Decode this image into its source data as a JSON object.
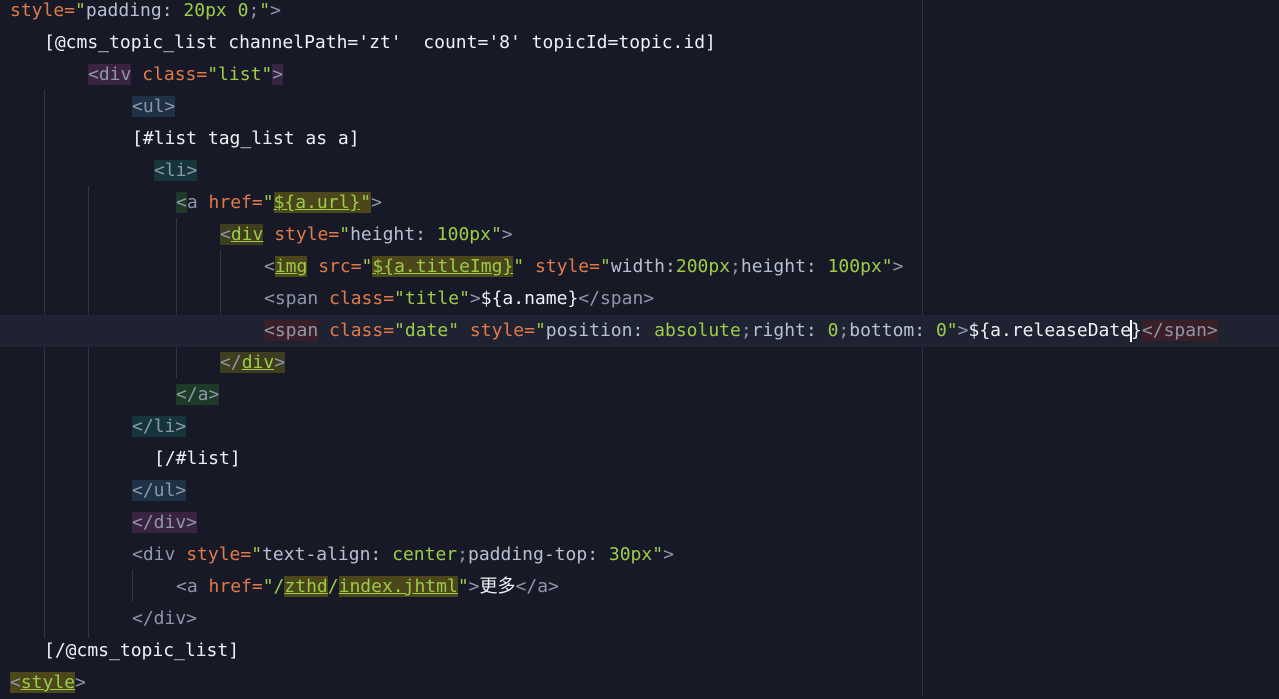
{
  "editor": {
    "lines": [
      {
        "indent": 0,
        "tokens": [
          {
            "t": "style=",
            "c": "tok-attr"
          },
          {
            "t": "\"",
            "c": "tok-str"
          },
          {
            "t": "padding: ",
            "c": "tok-css"
          },
          {
            "t": "20px 0",
            "c": "tok-val"
          },
          {
            "t": ";",
            "c": "tok-punct"
          },
          {
            "t": "\"",
            "c": "tok-str"
          },
          {
            "t": ">",
            "c": "tok-punct"
          }
        ]
      },
      {
        "indent": 1,
        "tokens": [
          {
            "t": "[@cms_topic_list channelPath='zt'  count='8' topicId=topic.id]",
            "c": "tok-ftl"
          }
        ]
      },
      {
        "indent": 2,
        "tokens": [
          {
            "t": "<div",
            "c": "tok-tag",
            "h": "hl-purple"
          },
          {
            "t": " class=",
            "c": "tok-attr"
          },
          {
            "t": "\"list\"",
            "c": "tok-str"
          },
          {
            "t": ">",
            "c": "tok-punct",
            "h": "hl-purple"
          }
        ]
      },
      {
        "indent": 3,
        "tokens": [
          {
            "t": "<ul>",
            "c": "tok-tag",
            "h": "hl-blue"
          }
        ]
      },
      {
        "indent": 3,
        "tokens": [
          {
            "t": "[#list tag_list as a]",
            "c": "tok-ftl"
          }
        ]
      },
      {
        "indent": 3.5,
        "tokens": [
          {
            "t": "<li>",
            "c": "tok-tag",
            "h": "hl-teal"
          }
        ]
      },
      {
        "indent": 4,
        "tokens": [
          {
            "t": "<",
            "c": "tok-tag",
            "h": "hl-green"
          },
          {
            "t": "a",
            "c": "tok-tag"
          },
          {
            "t": " href=",
            "c": "tok-attr"
          },
          {
            "t": "\"",
            "c": "tok-str"
          },
          {
            "t": "${a.url}",
            "c": "tok-link",
            "h": "hl-gold"
          },
          {
            "t": "\"",
            "c": "tok-str",
            "h": "hl-gold"
          },
          {
            "t": ">",
            "c": "tok-punct"
          }
        ]
      },
      {
        "indent": 5,
        "tokens": [
          {
            "t": "<",
            "c": "tok-tag",
            "h": "hl-olive"
          },
          {
            "t": "div",
            "c": "tok-link",
            "h": "hl-olive"
          },
          {
            "t": " style=",
            "c": "tok-attr"
          },
          {
            "t": "\"",
            "c": "tok-str"
          },
          {
            "t": "height: ",
            "c": "tok-css"
          },
          {
            "t": "100px",
            "c": "tok-val"
          },
          {
            "t": "\"",
            "c": "tok-str"
          },
          {
            "t": ">",
            "c": "tok-punct"
          }
        ]
      },
      {
        "indent": 6,
        "tokens": [
          {
            "t": "<",
            "c": "tok-tag"
          },
          {
            "t": "img",
            "c": "tok-link",
            "h": "hl-gold"
          },
          {
            "t": " src=",
            "c": "tok-attr"
          },
          {
            "t": "\"",
            "c": "tok-str"
          },
          {
            "t": "${a.titleImg}",
            "c": "tok-link",
            "h": "hl-gold"
          },
          {
            "t": "\"",
            "c": "tok-str"
          },
          {
            "t": " style=",
            "c": "tok-attr"
          },
          {
            "t": "\"",
            "c": "tok-str"
          },
          {
            "t": "width:",
            "c": "tok-css"
          },
          {
            "t": "200px",
            "c": "tok-val"
          },
          {
            "t": ";",
            "c": "tok-punct"
          },
          {
            "t": "height: ",
            "c": "tok-css"
          },
          {
            "t": "100px",
            "c": "tok-val"
          },
          {
            "t": "\"",
            "c": "tok-str"
          },
          {
            "t": ">",
            "c": "tok-punct"
          }
        ]
      },
      {
        "indent": 6,
        "tokens": [
          {
            "t": "<span",
            "c": "tok-tag"
          },
          {
            "t": " class=",
            "c": "tok-attr"
          },
          {
            "t": "\"title\"",
            "c": "tok-str"
          },
          {
            "t": ">",
            "c": "tok-punct"
          },
          {
            "t": "${a.name}",
            "c": "tok-plain"
          },
          {
            "t": "</span>",
            "c": "tok-tag"
          }
        ]
      },
      {
        "indent": 6,
        "current": true,
        "tokens": [
          {
            "t": "<span",
            "c": "tok-tag",
            "h": "hl-red"
          },
          {
            "t": " class=",
            "c": "tok-attr"
          },
          {
            "t": "\"date\"",
            "c": "tok-str"
          },
          {
            "t": " style=",
            "c": "tok-attr"
          },
          {
            "t": "\"",
            "c": "tok-str"
          },
          {
            "t": "position: ",
            "c": "tok-css"
          },
          {
            "t": "absolute",
            "c": "tok-val"
          },
          {
            "t": ";",
            "c": "tok-punct"
          },
          {
            "t": "right: ",
            "c": "tok-css"
          },
          {
            "t": "0",
            "c": "tok-val"
          },
          {
            "t": ";",
            "c": "tok-punct"
          },
          {
            "t": "bottom: ",
            "c": "tok-css"
          },
          {
            "t": "0",
            "c": "tok-val"
          },
          {
            "t": "\"",
            "c": "tok-str"
          },
          {
            "t": ">",
            "c": "tok-punct"
          },
          {
            "t": "${a.releaseDate",
            "c": "tok-plain"
          },
          {
            "caret": true
          },
          {
            "t": "}",
            "c": "tok-plain"
          },
          {
            "t": "</span>",
            "c": "tok-tag",
            "h": "hl-red"
          }
        ]
      },
      {
        "indent": 5,
        "tokens": [
          {
            "t": "</",
            "c": "tok-tag",
            "h": "hl-olive"
          },
          {
            "t": "div",
            "c": "tok-link",
            "h": "hl-olive"
          },
          {
            "t": ">",
            "c": "tok-punct",
            "h": "hl-olive"
          }
        ]
      },
      {
        "indent": 4,
        "tokens": [
          {
            "t": "</a>",
            "c": "tok-tag",
            "h": "hl-green"
          }
        ]
      },
      {
        "indent": 3,
        "tokens": [
          {
            "t": "</li>",
            "c": "tok-tag",
            "h": "hl-teal"
          }
        ]
      },
      {
        "indent": 3.5,
        "tokens": [
          {
            "t": "[/#list]",
            "c": "tok-ftl"
          }
        ]
      },
      {
        "indent": 3,
        "tokens": [
          {
            "t": "</ul>",
            "c": "tok-tag",
            "h": "hl-blue"
          }
        ]
      },
      {
        "indent": 3,
        "tokens": [
          {
            "t": "</div>",
            "c": "tok-tag",
            "h": "hl-purple"
          }
        ]
      },
      {
        "indent": 3,
        "tokens": [
          {
            "t": "<div",
            "c": "tok-tag"
          },
          {
            "t": " style=",
            "c": "tok-attr"
          },
          {
            "t": "\"",
            "c": "tok-str"
          },
          {
            "t": "text-align: ",
            "c": "tok-css"
          },
          {
            "t": "center",
            "c": "tok-val"
          },
          {
            "t": ";",
            "c": "tok-punct"
          },
          {
            "t": "padding-top: ",
            "c": "tok-css"
          },
          {
            "t": "30px",
            "c": "tok-val"
          },
          {
            "t": "\"",
            "c": "tok-str"
          },
          {
            "t": ">",
            "c": "tok-punct"
          }
        ]
      },
      {
        "indent": 4,
        "tokens": [
          {
            "t": "<a",
            "c": "tok-tag"
          },
          {
            "t": " href=",
            "c": "tok-attr"
          },
          {
            "t": "\"/",
            "c": "tok-str"
          },
          {
            "t": "zthd",
            "c": "tok-link",
            "h": "hl-gold"
          },
          {
            "t": "/",
            "c": "tok-str"
          },
          {
            "t": "index.jhtml",
            "c": "tok-link",
            "h": "hl-gold"
          },
          {
            "t": "\"",
            "c": "tok-str"
          },
          {
            "t": ">",
            "c": "tok-punct"
          },
          {
            "t": "更多",
            "c": "tok-plain"
          },
          {
            "t": "</a>",
            "c": "tok-tag"
          }
        ]
      },
      {
        "indent": 3,
        "tokens": [
          {
            "t": "</div>",
            "c": "tok-tag"
          }
        ]
      },
      {
        "indent": 1,
        "tokens": [
          {
            "t": "[/@cms_topic_list]",
            "c": "tok-ftl"
          }
        ]
      },
      {
        "indent": 0,
        "tokens": [
          {
            "t": "<",
            "c": "tok-tag",
            "h": "hl-gold"
          },
          {
            "t": "style",
            "c": "tok-link",
            "h": "hl-gold"
          },
          {
            "t": ">",
            "c": "tok-punct"
          }
        ]
      }
    ]
  }
}
